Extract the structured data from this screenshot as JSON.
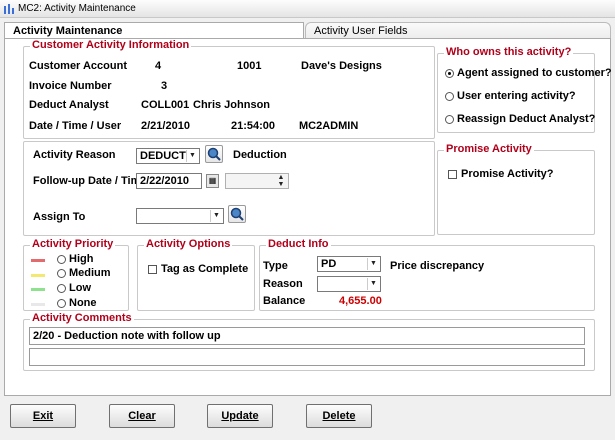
{
  "window": {
    "title": "MC2: Activity Maintenance"
  },
  "tabs": [
    {
      "label": "Activity Maintenance"
    },
    {
      "label": "Activity User Fields"
    }
  ],
  "customer_info": {
    "legend": "Customer Activity Information",
    "customer_account_label": "Customer Account",
    "customer_account_num": "4",
    "customer_code": "1001",
    "customer_name": "Dave's Designs",
    "invoice_number_label": "Invoice Number",
    "invoice_number": "3",
    "deduct_analyst_label": "Deduct Analyst",
    "deduct_analyst_code": "COLL001",
    "deduct_analyst_name": "Chris Johnson",
    "dtu_label": "Date / Time / User",
    "date": "2/21/2010",
    "time": "21:54:00",
    "user": "MC2ADMIN"
  },
  "owner": {
    "legend": "Who owns this activity?",
    "options": [
      "Agent assigned to customer?",
      "User entering activity?",
      "Reassign Deduct Analyst?"
    ],
    "selected_index": 0
  },
  "activity": {
    "reason_label": "Activity Reason",
    "reason_value": "DEDUCT",
    "reason_desc": "Deduction",
    "followup_label": "Follow-up Date / Time",
    "followup_date": "2/22/2010",
    "followup_time": "",
    "assign_label": "Assign To",
    "assign_value": ""
  },
  "promise": {
    "legend": "Promise Activity",
    "checkbox_label": "Promise Activity?"
  },
  "priority": {
    "legend": "Activity Priority",
    "options": [
      "High",
      "Medium",
      "Low",
      "None"
    ],
    "colors": [
      "#e36b6b",
      "#f2e872",
      "#8ee28e",
      "#e8e8e8"
    ]
  },
  "options": {
    "legend": "Activity Options",
    "tag_label": "Tag as Complete"
  },
  "deduct_info": {
    "legend": "Deduct Info",
    "type_label": "Type",
    "type_value": "PD",
    "type_desc": "Price discrepancy",
    "reason_label": "Reason",
    "reason_value": "",
    "balance_label": "Balance",
    "balance_value": "4,655.00"
  },
  "comments": {
    "legend": "Activity Comments",
    "line1": "2/20 - Deduction note with follow up",
    "line2": ""
  },
  "buttons": {
    "exit": "Exit",
    "clear": "Clear",
    "update": "Update",
    "delete": "Delete"
  },
  "colors": {
    "accent": "#b0001a",
    "balance": "#cc0000"
  }
}
